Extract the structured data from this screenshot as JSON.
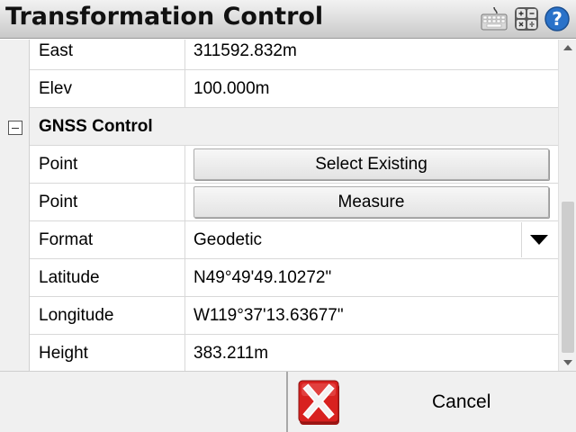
{
  "window": {
    "title": "Transformation Control"
  },
  "toolbar_icons": [
    "keyboard-icon",
    "calculator-icon",
    "help-icon"
  ],
  "rows_top": [
    {
      "label": "East",
      "value": "311592.832m"
    },
    {
      "label": "Elev",
      "value": "100.000m"
    }
  ],
  "section": {
    "title": "GNSS Control",
    "expanded": true
  },
  "buttons": [
    {
      "label": "Point",
      "button": "Select Existing"
    },
    {
      "label": "Point",
      "button": "Measure"
    }
  ],
  "format": {
    "label": "Format",
    "selected": "Geodetic"
  },
  "rows_bottom": [
    {
      "label": "Latitude",
      "value": "N49°49'49.10272\""
    },
    {
      "label": "Longitude",
      "value": "W119°37'13.63677\""
    },
    {
      "label": "Height",
      "value": "383.211m"
    }
  ],
  "footer": {
    "cancel_label": "Cancel"
  },
  "colors": {
    "cancel_red": "#d8211f",
    "help_blue": "#2a72c9"
  }
}
